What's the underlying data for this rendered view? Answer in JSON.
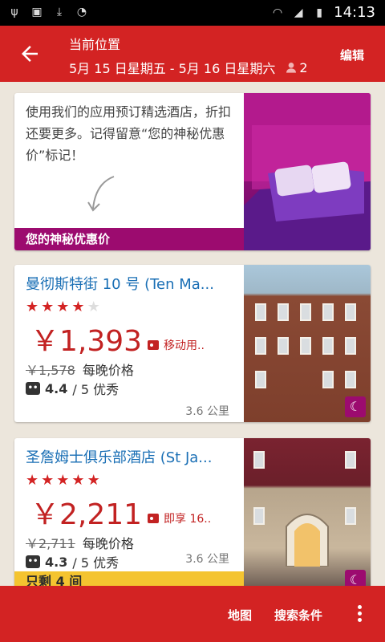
{
  "status_bar": {
    "time": "14:13",
    "icons": [
      "usb-icon",
      "image-icon",
      "download-icon",
      "timer-icon",
      "wifi-icon",
      "signal-icon",
      "battery-icon"
    ]
  },
  "header": {
    "title": "当前位置",
    "dates": "5月 15 日星期五 - 5月 16 日星期六",
    "guests": "2",
    "edit_label": "编辑",
    "accent_color": "#d32323"
  },
  "promo": {
    "text": "使用我们的应用预订精选酒店，折扣还要更多。记得留意“您的神秘优惠价”标记！",
    "bar_label": "您的神秘优惠价",
    "bar_color": "#9c0b6f"
  },
  "hotels": [
    {
      "name": "曼彻斯特街 10 号 (Ten Ma...",
      "stars": 4,
      "price": "￥1,393",
      "deal": "移动用..",
      "old_price": "￥1,578",
      "per_night": "每晚价格",
      "rating": "4.4",
      "rating_suffix": "/ 5 优秀",
      "distance": "3.6 公里"
    },
    {
      "name": "圣詹姆士俱乐部酒店 (St Ja...",
      "stars": 5,
      "price": "￥2,211",
      "deal": "即享 16..",
      "old_price": "￥2,711",
      "per_night": "每晚价格",
      "rating": "4.3",
      "rating_suffix": "/ 5 优秀",
      "distance": "3.6 公里",
      "remaining": "只剩 4 间"
    }
  ],
  "bottom_bar": {
    "map_label": "地图",
    "filter_label": "搜索条件"
  }
}
